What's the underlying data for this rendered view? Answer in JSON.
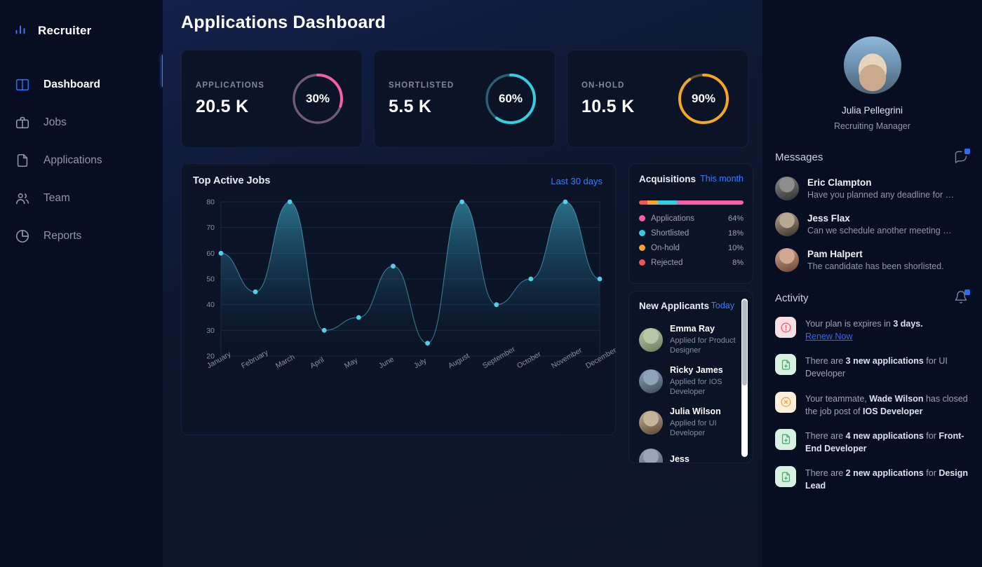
{
  "sidebar": {
    "brand": "Recruiter",
    "brand_icon": "bar-chart-icon",
    "items": [
      {
        "label": "Dashboard",
        "icon": "layout-panel-icon",
        "active": true
      },
      {
        "label": "Jobs",
        "icon": "briefcase-icon",
        "active": false
      },
      {
        "label": "Applications",
        "icon": "document-icon",
        "active": false
      },
      {
        "label": "Team",
        "icon": "people-icon",
        "active": false
      },
      {
        "label": "Reports",
        "icon": "pie-chart-icon",
        "active": false
      }
    ]
  },
  "main": {
    "page_title": "Applications Dashboard",
    "kpis": [
      {
        "label": "APPLICATIONS",
        "value": "20.5 K",
        "percent_text": "30%",
        "percent": 30,
        "color": "#f45fa8",
        "track": "#6f5a78"
      },
      {
        "label": "SHORTLISTED",
        "value": "5.5 K",
        "percent_text": "60%",
        "percent": 60,
        "color": "#33cfe0",
        "track": "#2b5f75"
      },
      {
        "label": "ON-HOLD",
        "value": "10.5 K",
        "percent_text": "90%",
        "percent": 90,
        "color": "#f5a623",
        "track": "#5d5130"
      }
    ],
    "chart_card": {
      "title": "Top Active Jobs",
      "range_label": "Last 30 days"
    },
    "acquisitions": {
      "title": "Acquisitions",
      "range_label": "This month",
      "rows": [
        {
          "label": "Applications",
          "pct_text": "64%",
          "pct": 64,
          "color": "#f45fa8"
        },
        {
          "label": "Shortlisted",
          "pct_text": "18%",
          "pct": 18,
          "color": "#33cfe0"
        },
        {
          "label": "On-hold",
          "pct_text": "10%",
          "pct": 10,
          "color": "#f5a623"
        },
        {
          "label": "Rejected",
          "pct_text": "8%",
          "pct": 8,
          "color": "#f0574f"
        }
      ]
    },
    "new_applicants": {
      "title": "New Applicants",
      "range_label": "Today",
      "items": [
        {
          "name": "Emma Ray",
          "sub": "Applied for Product Designer",
          "avatar": "#b9c7a8,#6d7d5e"
        },
        {
          "name": "Ricky James",
          "sub": "Applied for IOS Developer",
          "avatar": "#8fa3b8,#3d4c5e"
        },
        {
          "name": "Julia Wilson",
          "sub": "Applied for UI Developer",
          "avatar": "#c7b39b,#5a4634"
        },
        {
          "name": "Jess",
          "sub": "",
          "avatar": "#9aa6b5,#4a5360"
        }
      ]
    }
  },
  "chart_data": {
    "type": "area",
    "title": "Top Active Jobs",
    "xlabel": "",
    "ylabel": "",
    "ylim": [
      20,
      80
    ],
    "yticks": [
      20,
      30,
      40,
      50,
      60,
      70,
      80
    ],
    "grid": true,
    "legend": "none",
    "line_color": "#4fd2e8",
    "categories": [
      "January",
      "February",
      "March",
      "April",
      "May",
      "June",
      "July",
      "August",
      "September",
      "October",
      "November",
      "December"
    ],
    "values": [
      60,
      45,
      80,
      30,
      35,
      55,
      25,
      80,
      40,
      50,
      80,
      50
    ]
  },
  "right": {
    "profile": {
      "name": "Julia Pellegrini",
      "role": "Recruiting Manager"
    },
    "messages": {
      "title": "Messages",
      "icon": "chat-bubble-icon",
      "items": [
        {
          "name": "Eric Clampton",
          "text": "Have you planned any deadline for …",
          "avatar": "#8d8d8d,#2e2e2e"
        },
        {
          "name": "Jess Flax",
          "text": "Can we schedule another meeting …",
          "avatar": "#b9a894,#3b3026"
        },
        {
          "name": "Pam Halpert",
          "text": "The candidate has been shorlisted.",
          "avatar": "#d2a893,#6b4436"
        }
      ]
    },
    "activity": {
      "title": "Activity",
      "icon": "bell-icon",
      "items": [
        {
          "icon": "alert-circle-icon",
          "bg": "#fadfe3",
          "stroke": "#e8556d",
          "parts": [
            {
              "t": "Your plan is expires in ",
              "b": false
            },
            {
              "t": "3 days.",
              "b": true
            }
          ],
          "link": "Renew Now"
        },
        {
          "icon": "file-plus-icon",
          "bg": "#d8f2e2",
          "stroke": "#3ea76e",
          "parts": [
            {
              "t": "There are ",
              "b": false
            },
            {
              "t": "3 new applications",
              "b": true
            },
            {
              "t": " for UI Developer",
              "b": false
            }
          ],
          "link": ""
        },
        {
          "icon": "x-circle-icon",
          "bg": "#fbeedb",
          "stroke": "#e9a13b",
          "parts": [
            {
              "t": "Your teammate, ",
              "b": false
            },
            {
              "t": "Wade Wilson",
              "b": true
            },
            {
              "t": " has closed the job post of ",
              "b": false
            },
            {
              "t": "IOS Developer",
              "b": true
            }
          ],
          "link": ""
        },
        {
          "icon": "file-plus-icon",
          "bg": "#d8f2e2",
          "stroke": "#3ea76e",
          "parts": [
            {
              "t": "There are ",
              "b": false
            },
            {
              "t": "4 new applications",
              "b": true
            },
            {
              "t": " for ",
              "b": false
            },
            {
              "t": "Front-End Developer",
              "b": true
            }
          ],
          "link": ""
        },
        {
          "icon": "file-plus-icon",
          "bg": "#d8f2e2",
          "stroke": "#3ea76e",
          "parts": [
            {
              "t": "There are ",
              "b": false
            },
            {
              "t": "2 new applications",
              "b": true
            },
            {
              "t": " for ",
              "b": false
            },
            {
              "t": "Design Lead",
              "b": true
            }
          ],
          "link": ""
        }
      ]
    }
  }
}
